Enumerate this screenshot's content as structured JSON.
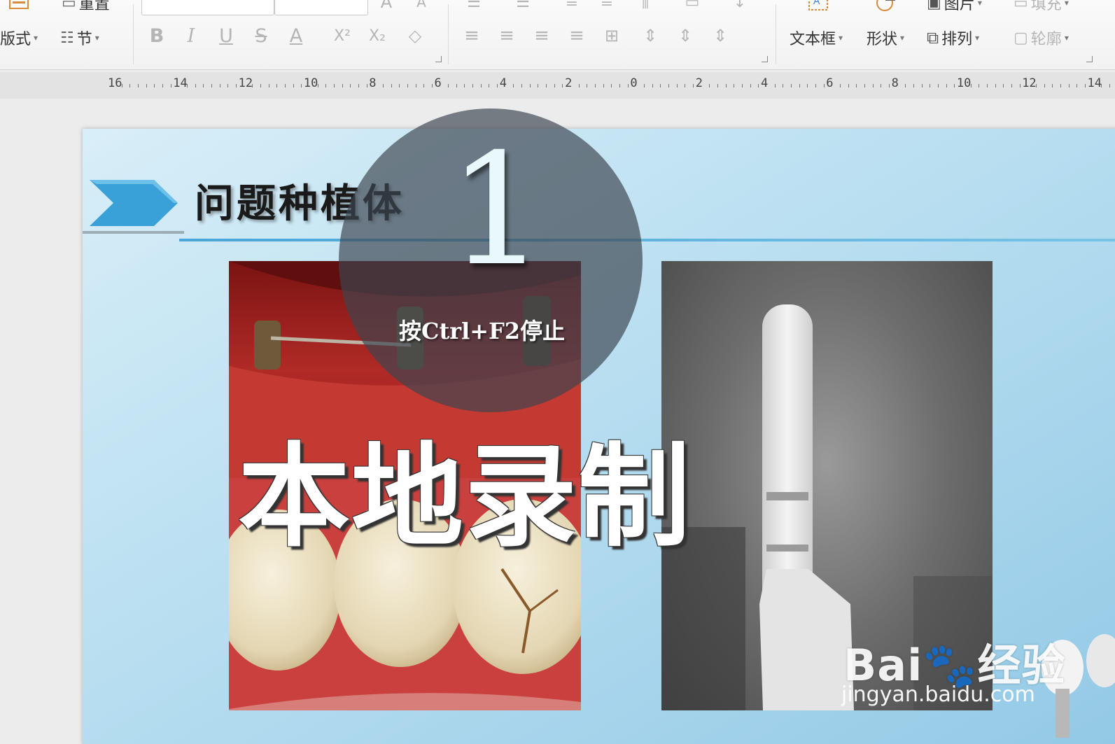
{
  "ribbon": {
    "layout_label": "版式",
    "reset_label": "重置",
    "section_label": "节",
    "textbox_label": "文本框",
    "shape_label": "形状",
    "arrange_label": "排列",
    "picture_label": "图片",
    "outline_label": "轮廓",
    "fill_label": "填充"
  },
  "ruler": {
    "labels": [
      "16",
      "14",
      "12",
      "10",
      "8",
      "6",
      "4",
      "2",
      "0",
      "2",
      "4",
      "6",
      "8",
      "10",
      "12",
      "14"
    ]
  },
  "slide": {
    "title": "问题种植体"
  },
  "recording": {
    "countdown": "1",
    "stop_hint": "按Ctrl+F2停止",
    "label": "本地录制"
  },
  "watermark": {
    "brand": "Bai🐾经验",
    "url": "jingyan.baidu.com"
  }
}
